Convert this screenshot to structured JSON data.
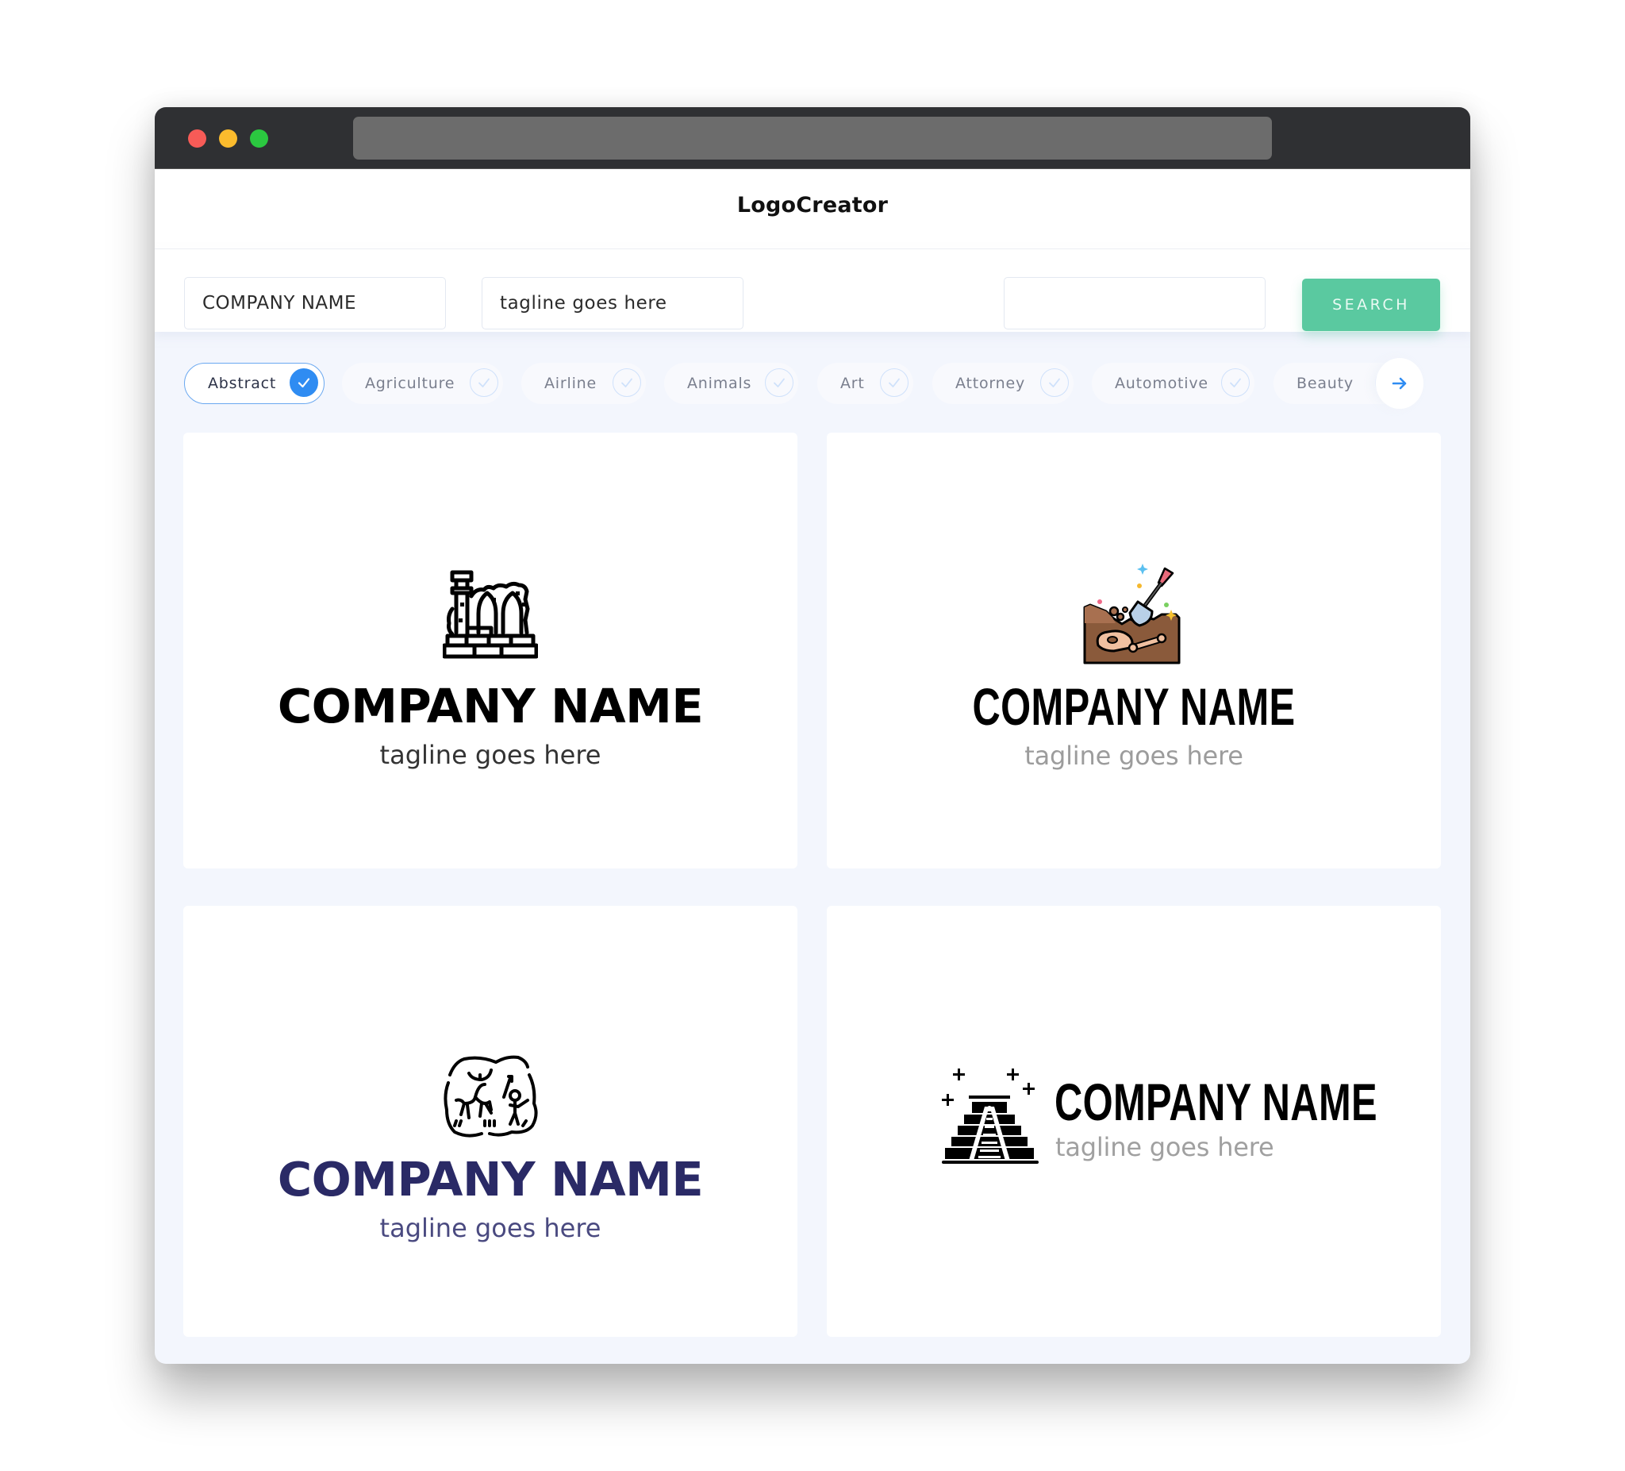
{
  "window": {
    "traffic_lights": [
      "close",
      "minimize",
      "maximize"
    ],
    "address_bar": ""
  },
  "header": {
    "title": "LogoCreator"
  },
  "search": {
    "company_name_value": "COMPANY NAME",
    "tagline_value": "tagline goes here",
    "keyword_value": "",
    "button_label": "SEARCH"
  },
  "categories": {
    "items": [
      {
        "label": "Abstract",
        "selected": true
      },
      {
        "label": "Agriculture",
        "selected": false
      },
      {
        "label": "Airline",
        "selected": false
      },
      {
        "label": "Animals",
        "selected": false
      },
      {
        "label": "Art",
        "selected": false
      },
      {
        "label": "Attorney",
        "selected": false
      },
      {
        "label": "Automotive",
        "selected": false
      },
      {
        "label": "Beauty",
        "selected": false
      }
    ],
    "next_icon": "arrow-right-icon"
  },
  "logos": [
    {
      "icon": "ruins-icon",
      "company_name": "COMPANY NAME",
      "tagline": "tagline goes here",
      "name_color": "#000000",
      "tagline_color": "#333333",
      "layout": "stacked"
    },
    {
      "icon": "archaeology-dig-icon",
      "company_name": "COMPANY NAME",
      "tagline": "tagline goes here",
      "name_color": "#000000",
      "tagline_color": "#9c9c9c",
      "layout": "stacked"
    },
    {
      "icon": "cave-painting-icon",
      "company_name": "COMPANY NAME",
      "tagline": "tagline goes here",
      "name_color": "#2a2a66",
      "tagline_color": "#4a4a80",
      "layout": "stacked"
    },
    {
      "icon": "pyramid-temple-icon",
      "company_name": "COMPANY NAME",
      "tagline": "tagline goes here",
      "name_color": "#000000",
      "tagline_color": "#a0a0a0",
      "layout": "inline"
    }
  ],
  "colors": {
    "accent_blue": "#2f8cf2",
    "search_green": "#5ac9a0",
    "titlebar": "#2f3033",
    "page_bg": "#f3f6fd"
  }
}
